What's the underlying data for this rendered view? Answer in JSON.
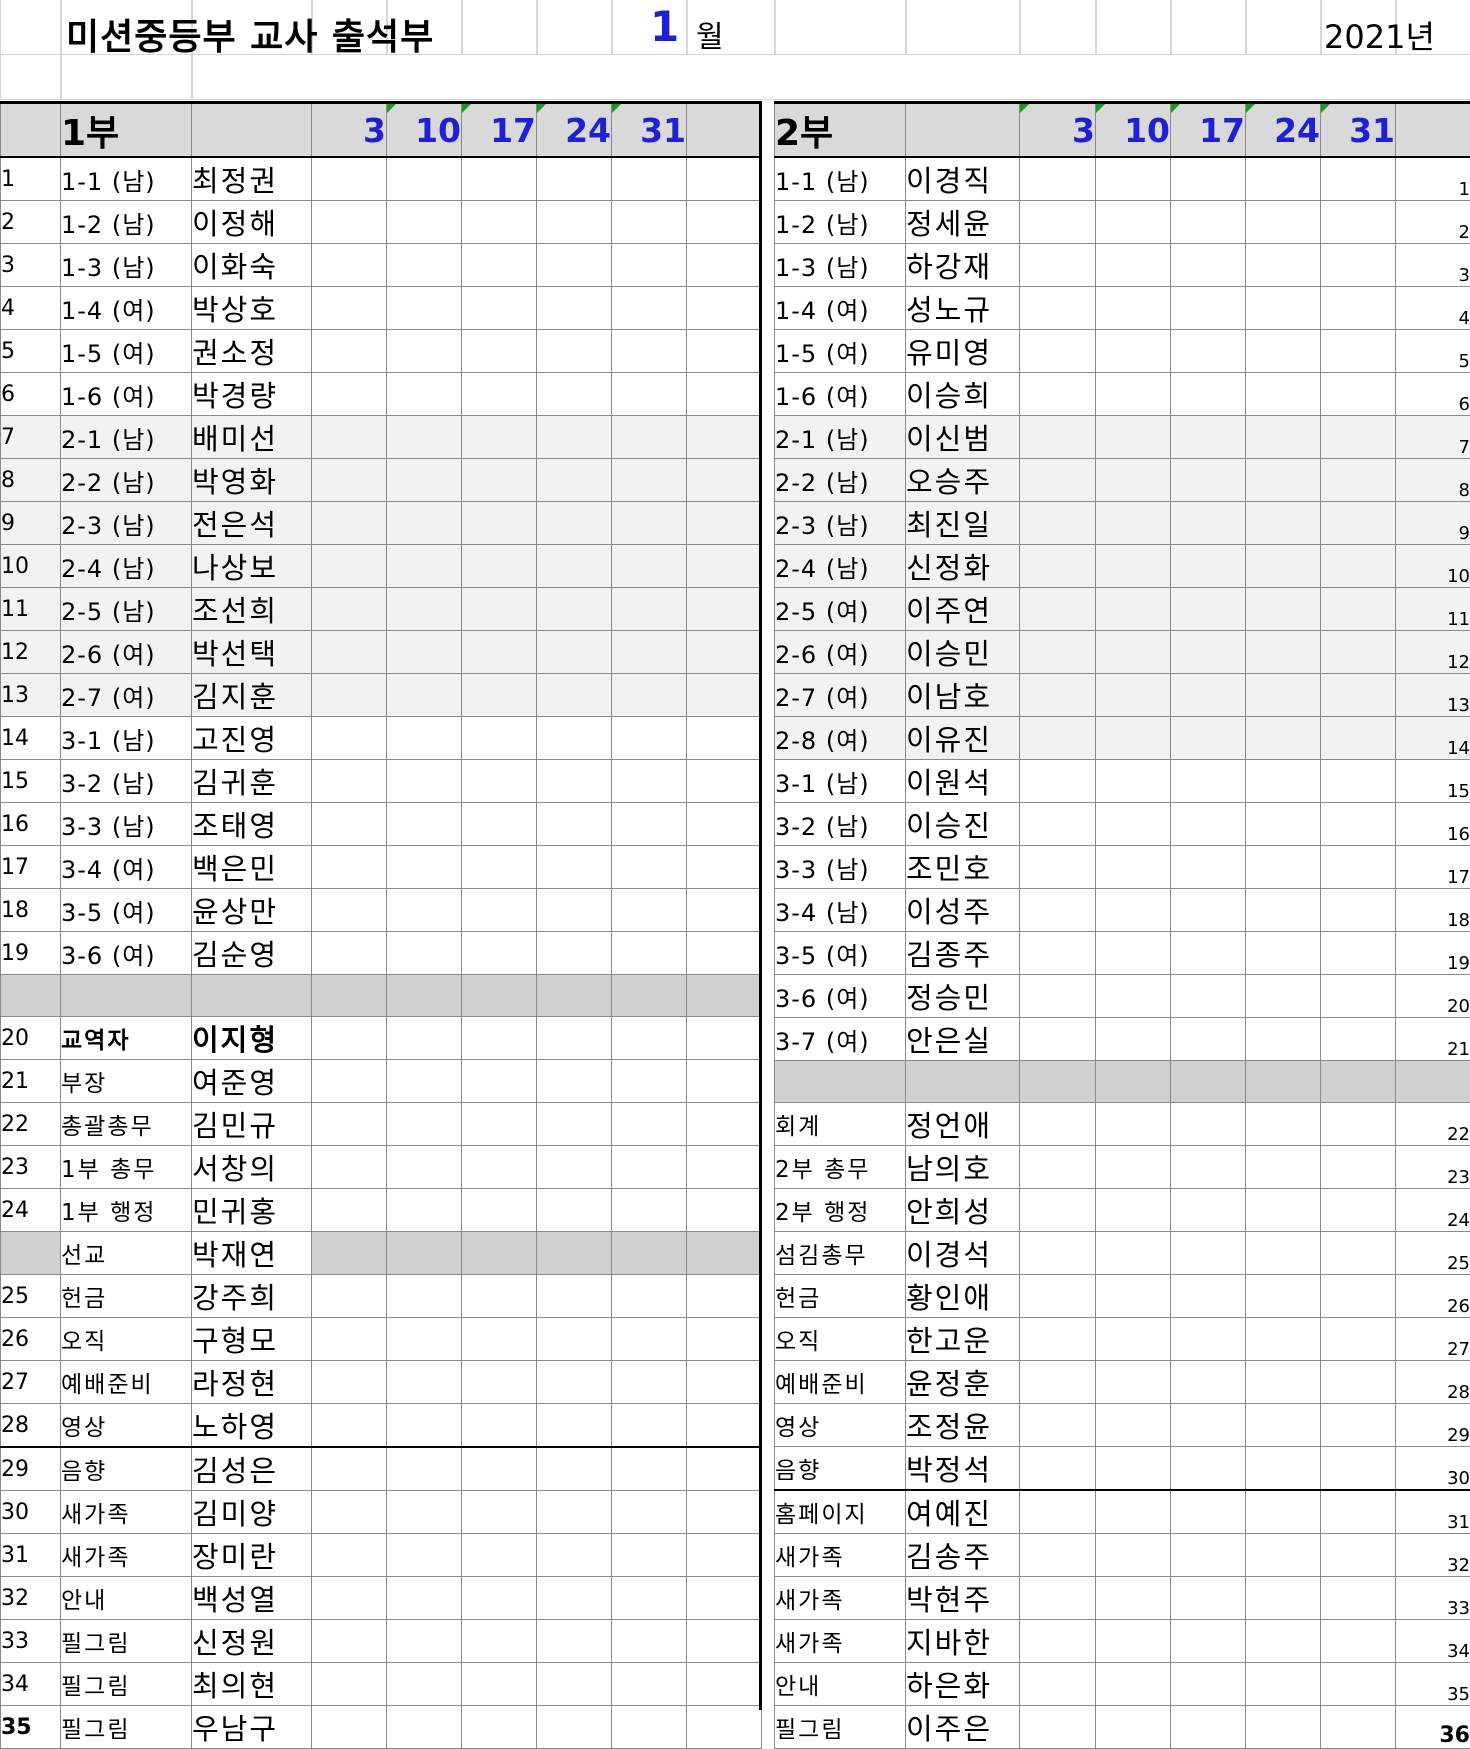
{
  "header": {
    "title": "미션중등부 교사 출석부",
    "month_number": "1",
    "month_label": "월",
    "year": "2021년"
  },
  "dates": [
    "3",
    "10",
    "17",
    "24",
    "31"
  ],
  "part1": {
    "label": "1부",
    "rows": [
      {
        "num": "1",
        "cls": "1-1 (남)",
        "name": "최정권"
      },
      {
        "num": "2",
        "cls": "1-2 (남)",
        "name": "이정해"
      },
      {
        "num": "3",
        "cls": "1-3 (남)",
        "name": "이화숙"
      },
      {
        "num": "4",
        "cls": "1-4 (여)",
        "name": "박상호"
      },
      {
        "num": "5",
        "cls": "1-5 (여)",
        "name": "권소정"
      },
      {
        "num": "6",
        "cls": "1-6 (여)",
        "name": "박경량"
      },
      {
        "num": "7",
        "cls": "2-1 (남)",
        "name": "배미선"
      },
      {
        "num": "8",
        "cls": "2-2 (남)",
        "name": "박영화"
      },
      {
        "num": "9",
        "cls": "2-3 (남)",
        "name": "전은석"
      },
      {
        "num": "10",
        "cls": "2-4 (남)",
        "name": "나상보"
      },
      {
        "num": "11",
        "cls": "2-5 (남)",
        "name": "조선희"
      },
      {
        "num": "12",
        "cls": "2-6 (여)",
        "name": "박선택"
      },
      {
        "num": "13",
        "cls": "2-7 (여)",
        "name": "김지훈"
      },
      {
        "num": "14",
        "cls": "3-1 (남)",
        "name": "고진영"
      },
      {
        "num": "15",
        "cls": "3-2 (남)",
        "name": "김귀훈"
      },
      {
        "num": "16",
        "cls": "3-3 (남)",
        "name": "조태영"
      },
      {
        "num": "17",
        "cls": "3-4 (여)",
        "name": "백은민"
      },
      {
        "num": "18",
        "cls": "3-5 (여)",
        "name": "윤상만"
      },
      {
        "num": "19",
        "cls": "3-6 (여)",
        "name": "김순영"
      },
      {
        "num": "",
        "cls": "",
        "name": ""
      },
      {
        "num": "20",
        "cls": "교역자",
        "name": "이지형"
      },
      {
        "num": "21",
        "cls": "부장",
        "name": "여준영"
      },
      {
        "num": "22",
        "cls": "총괄총무",
        "name": "김민규"
      },
      {
        "num": "23",
        "cls": "1부 총무",
        "name": "서창의"
      },
      {
        "num": "24",
        "cls": "1부 행정",
        "name": "민귀홍"
      },
      {
        "num": "",
        "cls": "선교",
        "name": "박재연"
      },
      {
        "num": "25",
        "cls": "헌금",
        "name": "강주희"
      },
      {
        "num": "26",
        "cls": "오직",
        "name": "구형모"
      },
      {
        "num": "27",
        "cls": "예배준비",
        "name": "라정현"
      },
      {
        "num": "28",
        "cls": "영상",
        "name": "노하영"
      },
      {
        "num": "29",
        "cls": "음향",
        "name": "김성은"
      },
      {
        "num": "30",
        "cls": "새가족",
        "name": "김미양"
      },
      {
        "num": "31",
        "cls": "새가족",
        "name": "장미란"
      },
      {
        "num": "32",
        "cls": "안내",
        "name": "백성열"
      },
      {
        "num": "33",
        "cls": "필그림",
        "name": "신정원"
      },
      {
        "num": "34",
        "cls": "필그림",
        "name": "최의현"
      },
      {
        "num": "35",
        "cls": "필그림",
        "name": "우남구"
      }
    ]
  },
  "part2": {
    "label": "2부",
    "rows": [
      {
        "num": "1",
        "cls": "1-1 (남)",
        "name": "이경직"
      },
      {
        "num": "2",
        "cls": "1-2 (남)",
        "name": "정세윤"
      },
      {
        "num": "3",
        "cls": "1-3 (남)",
        "name": "하강재"
      },
      {
        "num": "4",
        "cls": "1-4 (여)",
        "name": "성노규"
      },
      {
        "num": "5",
        "cls": "1-5 (여)",
        "name": "유미영"
      },
      {
        "num": "6",
        "cls": "1-6 (여)",
        "name": "이승희"
      },
      {
        "num": "7",
        "cls": "2-1 (남)",
        "name": "이신범"
      },
      {
        "num": "8",
        "cls": "2-2 (남)",
        "name": "오승주"
      },
      {
        "num": "9",
        "cls": "2-3 (남)",
        "name": "최진일"
      },
      {
        "num": "10",
        "cls": "2-4 (남)",
        "name": "신정화"
      },
      {
        "num": "11",
        "cls": "2-5 (여)",
        "name": "이주연"
      },
      {
        "num": "12",
        "cls": "2-6 (여)",
        "name": "이승민"
      },
      {
        "num": "13",
        "cls": "2-7 (여)",
        "name": "이남호"
      },
      {
        "num": "14",
        "cls": "2-8 (여)",
        "name": "이유진"
      },
      {
        "num": "15",
        "cls": "3-1 (남)",
        "name": "이원석"
      },
      {
        "num": "16",
        "cls": "3-2 (남)",
        "name": "이승진"
      },
      {
        "num": "17",
        "cls": "3-3 (남)",
        "name": "조민호"
      },
      {
        "num": "18",
        "cls": "3-4 (남)",
        "name": "이성주"
      },
      {
        "num": "19",
        "cls": "3-5 (여)",
        "name": "김종주"
      },
      {
        "num": "20",
        "cls": "3-6 (여)",
        "name": "정승민"
      },
      {
        "num": "21",
        "cls": "3-7 (여)",
        "name": "안은실"
      },
      {
        "num": "",
        "cls": "",
        "name": ""
      },
      {
        "num": "22",
        "cls": "회계",
        "name": "정언애"
      },
      {
        "num": "23",
        "cls": "2부 총무",
        "name": "남의호"
      },
      {
        "num": "24",
        "cls": "2부 행정",
        "name": "안희성"
      },
      {
        "num": "25",
        "cls": "섬김총무",
        "name": "이경석"
      },
      {
        "num": "26",
        "cls": "헌금",
        "name": "황인애"
      },
      {
        "num": "27",
        "cls": "오직",
        "name": "한고운"
      },
      {
        "num": "28",
        "cls": "예배준비",
        "name": "윤정훈"
      },
      {
        "num": "29",
        "cls": "영상",
        "name": "조정윤"
      },
      {
        "num": "30",
        "cls": "음향",
        "name": "박정석"
      },
      {
        "num": "31",
        "cls": "홈페이지",
        "name": "여예진"
      },
      {
        "num": "32",
        "cls": "새가족",
        "name": "김송주"
      },
      {
        "num": "33",
        "cls": "새가족",
        "name": "박현주"
      },
      {
        "num": "34",
        "cls": "새가족",
        "name": "지바한"
      },
      {
        "num": "35",
        "cls": "안내",
        "name": "하은화"
      },
      {
        "num": "36",
        "cls": "필그림",
        "name": "이주은"
      }
    ]
  }
}
